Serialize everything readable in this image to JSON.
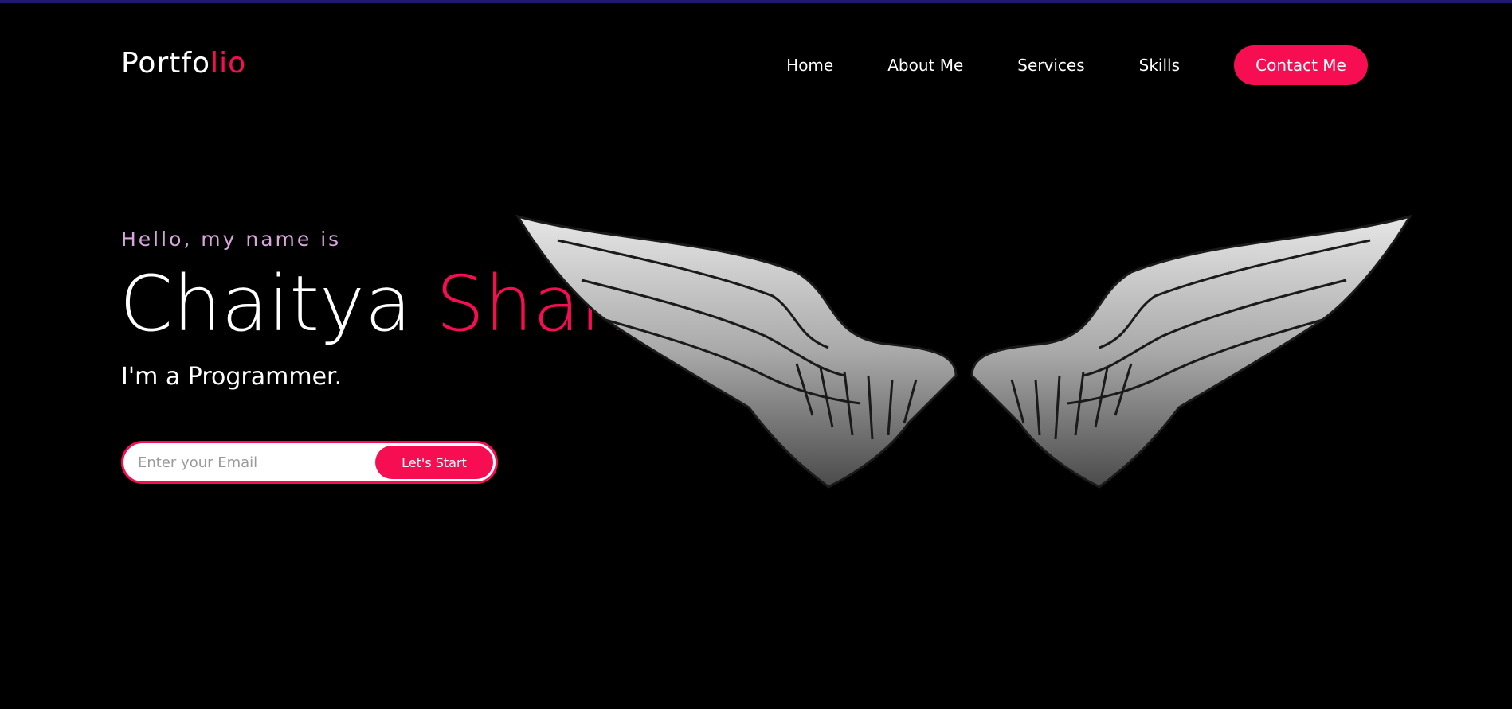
{
  "logo": {
    "text_main": "Portfo",
    "text_accent": "lio"
  },
  "nav": {
    "links": [
      "Home",
      "About Me",
      "Services",
      "Skills"
    ],
    "contact_label": "Contact Me"
  },
  "hero": {
    "greeting": "Hello, my name is",
    "first_name": "Chaitya",
    "last_name": "Shah",
    "subtitle": "I'm a Programmer.",
    "email_placeholder": "Enter your Email",
    "start_label": "Let's Start"
  },
  "colors": {
    "background": "#000000",
    "accent": "#f70d52",
    "greeting": "#d8a6dc",
    "top_strip": "#1f1a6e"
  },
  "icons": {
    "hero_image": "angel-wings-image"
  }
}
